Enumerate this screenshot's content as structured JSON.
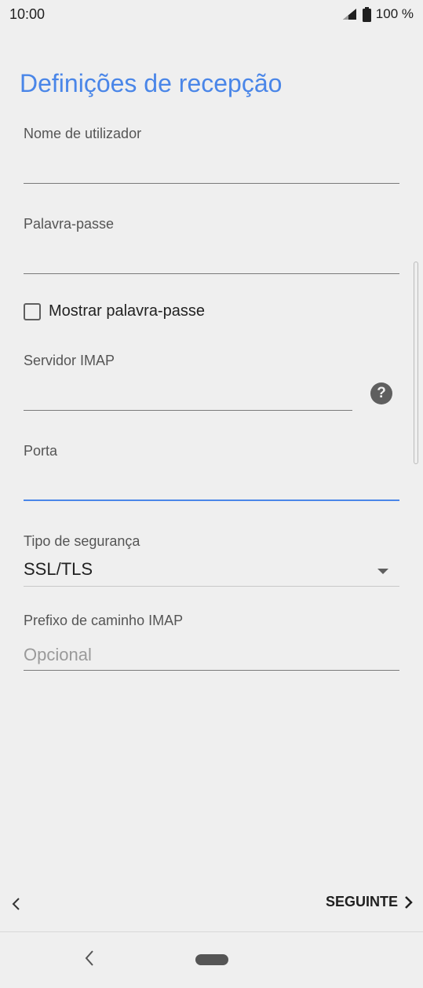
{
  "status_bar": {
    "time": "10:00",
    "battery_text": "100 %",
    "icons": [
      "signal-icon",
      "battery-icon"
    ]
  },
  "page": {
    "title": "Definições de recepção"
  },
  "fields": {
    "username": {
      "label": "Nome de utilizador",
      "value": ""
    },
    "password": {
      "label": "Palavra-passe",
      "value": ""
    },
    "show_password": {
      "label": "Mostrar palavra-passe",
      "checked": false
    },
    "imap_server": {
      "label": "Servidor IMAP",
      "value": ""
    },
    "port": {
      "label": "Porta",
      "value": ""
    },
    "security_type": {
      "label": "Tipo de segurança",
      "selected": "SSL/TLS"
    },
    "imap_path_prefix": {
      "label": "Prefixo de caminho IMAP",
      "placeholder": "Opcional",
      "value": ""
    }
  },
  "footer": {
    "back_label": "<",
    "next_label": "SEGUINTE",
    "next_chevron": "›"
  },
  "colors": {
    "accent": "#4a86e8",
    "background": "#efefef"
  }
}
